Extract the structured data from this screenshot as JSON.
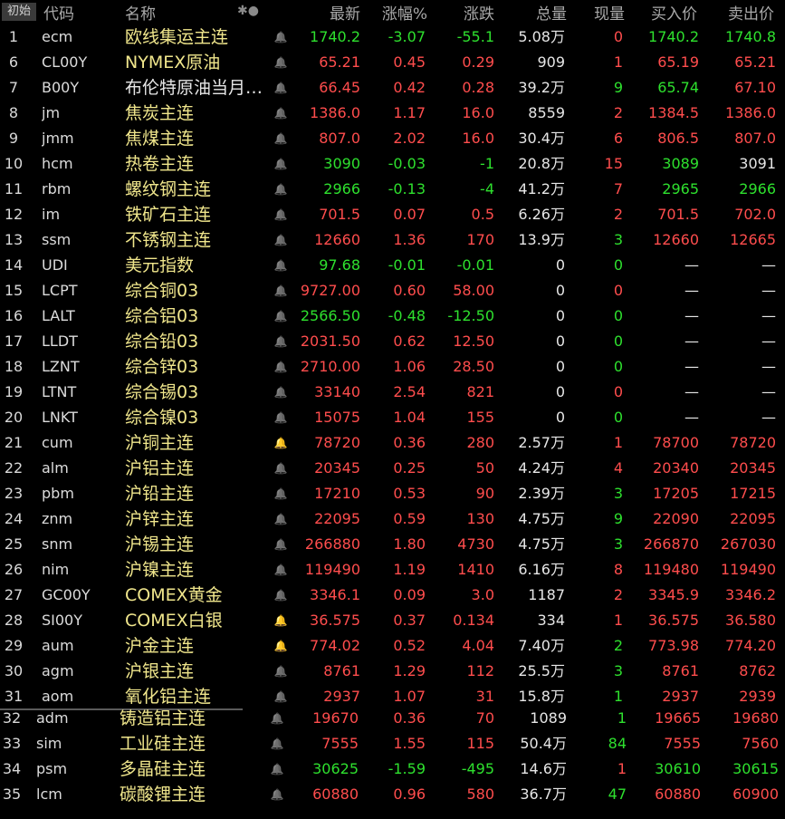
{
  "colors": {
    "red": "#ff4d4d",
    "green": "#2ee02e",
    "yellow": "#f0e68c",
    "white": "#e6e6e6",
    "orange_bell": "#ff4a1a"
  },
  "header": {
    "init": "初始",
    "code": "代码",
    "name": "名称",
    "icons": "✱●",
    "last": "最新",
    "pct": "涨幅%",
    "chg": "涨跌",
    "vol": "总量",
    "cur": "现量",
    "bid": "买入价",
    "ask": "卖出价"
  },
  "rows": [
    {
      "idx": "1",
      "code": "ecm",
      "name": "欧线集运主连",
      "bell": false,
      "last": "1740.2",
      "pct": "-3.07",
      "chg": "-55.1",
      "vol": "5.08万",
      "cur": "0",
      "bid": "1740.2",
      "ask": "1740.8",
      "dir": "down",
      "namecolor": "yellow",
      "curdir": "red"
    },
    {
      "idx": "6",
      "code": "CL00Y",
      "name": "NYMEX原油",
      "bell": false,
      "last": "65.21",
      "pct": "0.45",
      "chg": "0.29",
      "vol": "909",
      "cur": "1",
      "bid": "65.19",
      "ask": "65.21",
      "dir": "up",
      "namecolor": "yellow",
      "curdir": "red"
    },
    {
      "idx": "7",
      "code": "B00Y",
      "name": "布伦特原油当月…",
      "bell": false,
      "last": "66.45",
      "pct": "0.42",
      "chg": "0.28",
      "vol": "39.2万",
      "cur": "9",
      "bid": "65.74",
      "ask": "67.10",
      "dir": "up",
      "namecolor": "white",
      "curdir": "green",
      "biddir": "green"
    },
    {
      "idx": "8",
      "code": "jm",
      "name": "焦炭主连",
      "bell": false,
      "last": "1386.0",
      "pct": "1.17",
      "chg": "16.0",
      "vol": "8559",
      "cur": "2",
      "bid": "1384.5",
      "ask": "1386.0",
      "dir": "up",
      "namecolor": "yellow",
      "curdir": "red"
    },
    {
      "idx": "9",
      "code": "jmm",
      "name": "焦煤主连",
      "bell": false,
      "last": "807.0",
      "pct": "2.02",
      "chg": "16.0",
      "vol": "30.4万",
      "cur": "6",
      "bid": "806.5",
      "ask": "807.0",
      "dir": "up",
      "namecolor": "yellow",
      "curdir": "red"
    },
    {
      "idx": "10",
      "code": "hcm",
      "name": "热卷主连",
      "bell": false,
      "last": "3090",
      "pct": "-0.03",
      "chg": "-1",
      "vol": "20.8万",
      "cur": "15",
      "bid": "3089",
      "ask": "3091",
      "dir": "down",
      "namecolor": "yellow",
      "curdir": "red",
      "askdir": "white"
    },
    {
      "idx": "11",
      "code": "rbm",
      "name": "螺纹钢主连",
      "bell": false,
      "last": "2966",
      "pct": "-0.13",
      "chg": "-4",
      "vol": "41.2万",
      "cur": "7",
      "bid": "2965",
      "ask": "2966",
      "dir": "down",
      "namecolor": "yellow",
      "curdir": "red"
    },
    {
      "idx": "12",
      "code": "im",
      "name": "铁矿石主连",
      "bell": false,
      "last": "701.5",
      "pct": "0.07",
      "chg": "0.5",
      "vol": "6.26万",
      "cur": "2",
      "bid": "701.5",
      "ask": "702.0",
      "dir": "up",
      "namecolor": "yellow",
      "curdir": "red"
    },
    {
      "idx": "13",
      "code": "ssm",
      "name": "不锈钢主连",
      "bell": false,
      "last": "12660",
      "pct": "1.36",
      "chg": "170",
      "vol": "13.9万",
      "cur": "3",
      "bid": "12660",
      "ask": "12665",
      "dir": "up",
      "namecolor": "yellow",
      "curdir": "green"
    },
    {
      "idx": "14",
      "code": "UDI",
      "name": "美元指数",
      "bell": false,
      "last": "97.68",
      "pct": "-0.01",
      "chg": "-0.01",
      "vol": "0",
      "cur": "0",
      "bid": "—",
      "ask": "—",
      "dir": "down",
      "namecolor": "yellow",
      "curdir": "green"
    },
    {
      "idx": "15",
      "code": "LCPT",
      "name": "综合铜03",
      "bell": false,
      "last": "9727.00",
      "pct": "0.60",
      "chg": "58.00",
      "vol": "0",
      "cur": "0",
      "bid": "—",
      "ask": "—",
      "dir": "up",
      "namecolor": "yellow",
      "curdir": "red"
    },
    {
      "idx": "16",
      "code": "LALT",
      "name": "综合铝03",
      "bell": false,
      "last": "2566.50",
      "pct": "-0.48",
      "chg": "-12.50",
      "vol": "0",
      "cur": "0",
      "bid": "—",
      "ask": "—",
      "dir": "down",
      "namecolor": "yellow",
      "curdir": "green"
    },
    {
      "idx": "17",
      "code": "LLDT",
      "name": "综合铅03",
      "bell": false,
      "last": "2031.50",
      "pct": "0.62",
      "chg": "12.50",
      "vol": "0",
      "cur": "0",
      "bid": "—",
      "ask": "—",
      "dir": "up",
      "namecolor": "yellow",
      "curdir": "green"
    },
    {
      "idx": "18",
      "code": "LZNT",
      "name": "综合锌03",
      "bell": false,
      "last": "2710.00",
      "pct": "1.06",
      "chg": "28.50",
      "vol": "0",
      "cur": "0",
      "bid": "—",
      "ask": "—",
      "dir": "up",
      "namecolor": "yellow",
      "curdir": "green"
    },
    {
      "idx": "19",
      "code": "LTNT",
      "name": "综合锡03",
      "bell": false,
      "last": "33140",
      "pct": "2.54",
      "chg": "821",
      "vol": "0",
      "cur": "0",
      "bid": "—",
      "ask": "—",
      "dir": "up",
      "namecolor": "yellow",
      "curdir": "red"
    },
    {
      "idx": "20",
      "code": "LNKT",
      "name": "综合镍03",
      "bell": false,
      "last": "15075",
      "pct": "1.04",
      "chg": "155",
      "vol": "0",
      "cur": "0",
      "bid": "—",
      "ask": "—",
      "dir": "up",
      "namecolor": "yellow",
      "curdir": "green"
    },
    {
      "idx": "21",
      "code": "cum",
      "name": "沪铜主连",
      "bell": true,
      "last": "78720",
      "pct": "0.36",
      "chg": "280",
      "vol": "2.57万",
      "cur": "1",
      "bid": "78700",
      "ask": "78720",
      "dir": "up",
      "namecolor": "yellow",
      "curdir": "red"
    },
    {
      "idx": "22",
      "code": "alm",
      "name": "沪铝主连",
      "bell": false,
      "last": "20345",
      "pct": "0.25",
      "chg": "50",
      "vol": "4.24万",
      "cur": "4",
      "bid": "20340",
      "ask": "20345",
      "dir": "up",
      "namecolor": "yellow",
      "curdir": "red"
    },
    {
      "idx": "23",
      "code": "pbm",
      "name": "沪铅主连",
      "bell": false,
      "last": "17210",
      "pct": "0.53",
      "chg": "90",
      "vol": "2.39万",
      "cur": "3",
      "bid": "17205",
      "ask": "17215",
      "dir": "up",
      "namecolor": "yellow",
      "curdir": "green"
    },
    {
      "idx": "24",
      "code": "znm",
      "name": "沪锌主连",
      "bell": false,
      "last": "22095",
      "pct": "0.59",
      "chg": "130",
      "vol": "4.75万",
      "cur": "9",
      "bid": "22090",
      "ask": "22095",
      "dir": "up",
      "namecolor": "yellow",
      "curdir": "green"
    },
    {
      "idx": "25",
      "code": "snm",
      "name": "沪锡主连",
      "bell": false,
      "last": "266880",
      "pct": "1.80",
      "chg": "4730",
      "vol": "4.75万",
      "cur": "3",
      "bid": "266870",
      "ask": "267030",
      "dir": "up",
      "namecolor": "yellow",
      "curdir": "green"
    },
    {
      "idx": "26",
      "code": "nim",
      "name": "沪镍主连",
      "bell": false,
      "last": "119490",
      "pct": "1.19",
      "chg": "1410",
      "vol": "6.16万",
      "cur": "8",
      "bid": "119480",
      "ask": "119490",
      "dir": "up",
      "namecolor": "yellow",
      "curdir": "red"
    },
    {
      "idx": "27",
      "code": "GC00Y",
      "name": "COMEX黄金",
      "bell": false,
      "last": "3346.1",
      "pct": "0.09",
      "chg": "3.0",
      "vol": "1187",
      "cur": "2",
      "bid": "3345.9",
      "ask": "3346.2",
      "dir": "up",
      "namecolor": "yellow",
      "curdir": "red"
    },
    {
      "idx": "28",
      "code": "SI00Y",
      "name": "COMEX白银",
      "bell": true,
      "last": "36.575",
      "pct": "0.37",
      "chg": "0.134",
      "vol": "334",
      "cur": "1",
      "bid": "36.575",
      "ask": "36.580",
      "dir": "up",
      "namecolor": "yellow",
      "curdir": "red"
    },
    {
      "idx": "29",
      "code": "aum",
      "name": "沪金主连",
      "bell": true,
      "last": "774.02",
      "pct": "0.52",
      "chg": "4.04",
      "vol": "7.40万",
      "cur": "2",
      "bid": "773.98",
      "ask": "774.20",
      "dir": "up",
      "namecolor": "yellow",
      "curdir": "green"
    },
    {
      "idx": "30",
      "code": "agm",
      "name": "沪银主连",
      "bell": false,
      "last": "8761",
      "pct": "1.29",
      "chg": "112",
      "vol": "25.5万",
      "cur": "3",
      "bid": "8761",
      "ask": "8762",
      "dir": "up",
      "namecolor": "yellow",
      "curdir": "green"
    },
    {
      "idx": "31",
      "code": "aom",
      "name": "氧化铝主连",
      "bell": false,
      "last": "2937",
      "pct": "1.07",
      "chg": "31",
      "vol": "15.8万",
      "cur": "1",
      "bid": "2937",
      "ask": "2939",
      "dir": "up",
      "namecolor": "yellow",
      "curdir": "green"
    }
  ],
  "lower_rows": [
    {
      "idx": "32",
      "code": "adm",
      "name": "铸造铝主连",
      "bell": false,
      "last": "19670",
      "pct": "0.36",
      "chg": "70",
      "vol": "1089",
      "cur": "1",
      "bid": "19665",
      "ask": "19680",
      "dir": "up",
      "namecolor": "yellow",
      "curdir": "green"
    },
    {
      "idx": "33",
      "code": "sim",
      "name": "工业硅主连",
      "bell": false,
      "last": "7555",
      "pct": "1.55",
      "chg": "115",
      "vol": "50.4万",
      "cur": "84",
      "bid": "7555",
      "ask": "7560",
      "dir": "up",
      "namecolor": "yellow",
      "curdir": "green"
    },
    {
      "idx": "34",
      "code": "psm",
      "name": "多晶硅主连",
      "bell": false,
      "last": "30625",
      "pct": "-1.59",
      "chg": "-495",
      "vol": "14.6万",
      "cur": "1",
      "bid": "30610",
      "ask": "30615",
      "dir": "down",
      "namecolor": "yellow",
      "curdir": "red"
    },
    {
      "idx": "35",
      "code": "lcm",
      "name": "碳酸锂主连",
      "bell": false,
      "last": "60880",
      "pct": "0.96",
      "chg": "580",
      "vol": "36.7万",
      "cur": "47",
      "bid": "60880",
      "ask": "60900",
      "dir": "up",
      "namecolor": "yellow",
      "curdir": "green"
    }
  ]
}
